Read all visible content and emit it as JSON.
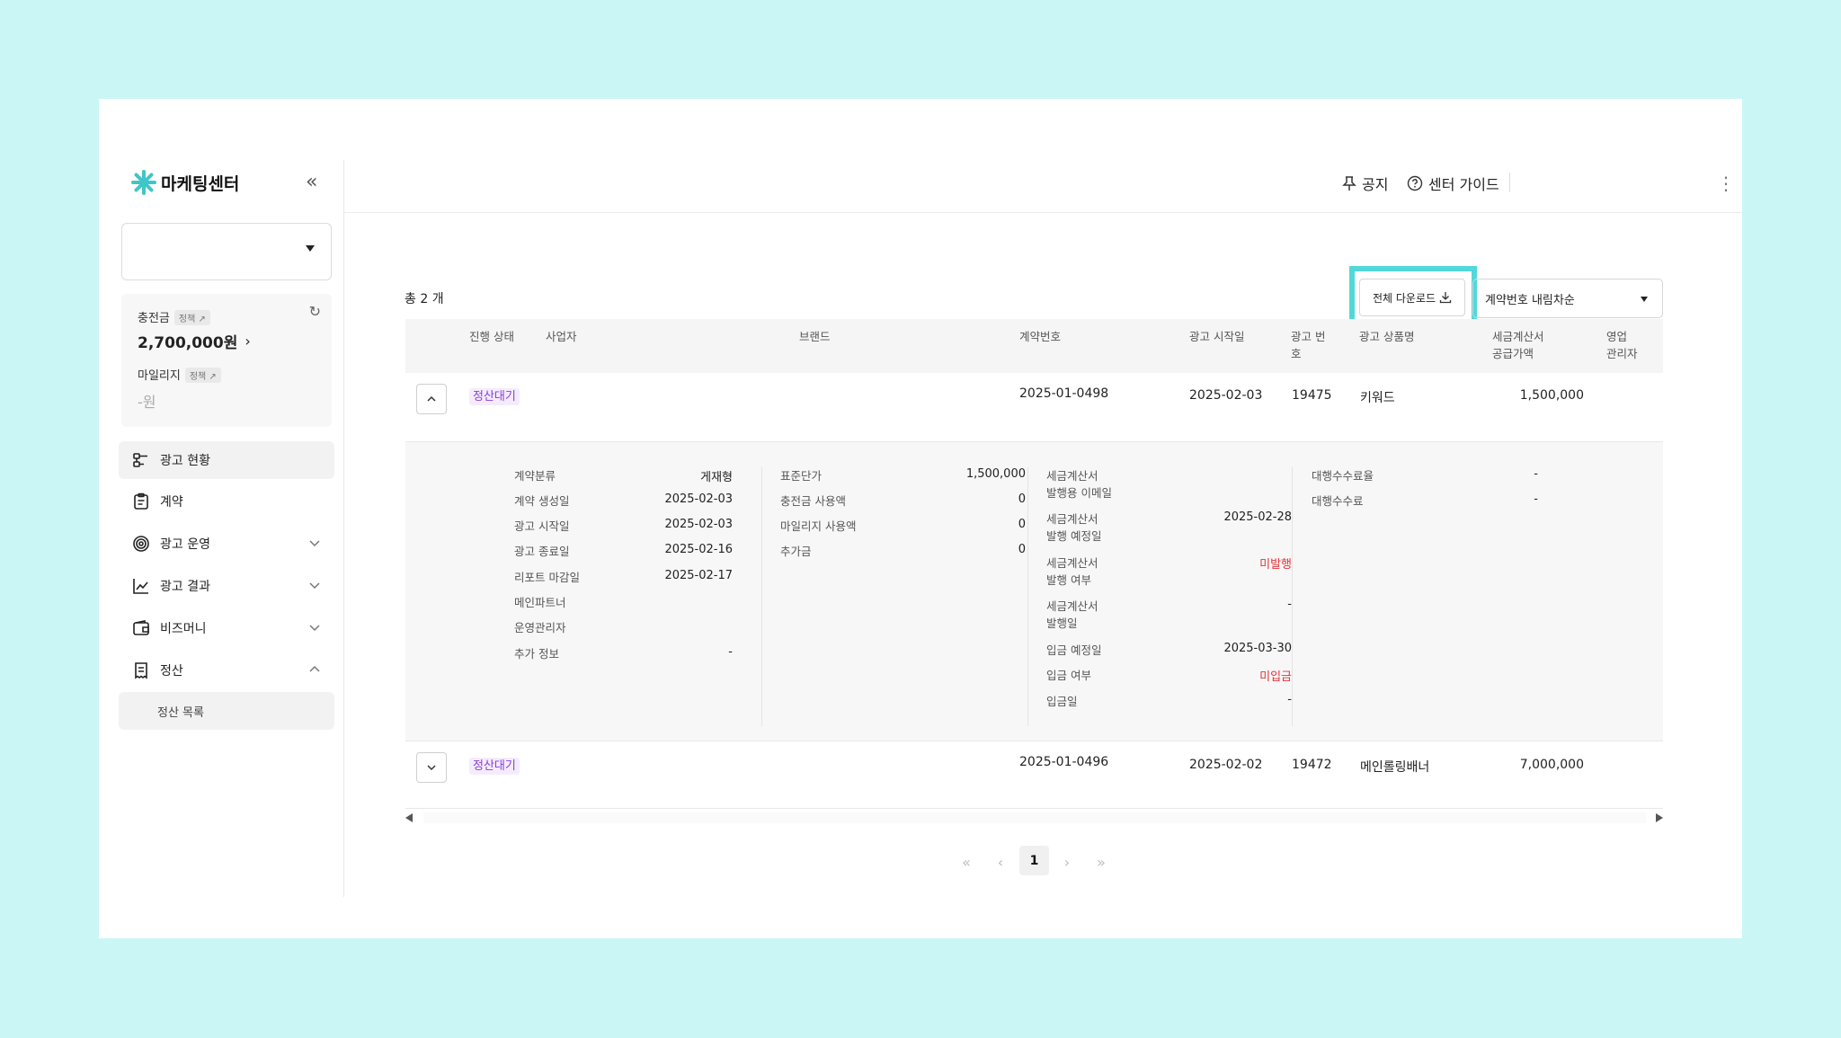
{
  "app": {
    "title": "마케팅센터"
  },
  "sidebar": {
    "balance": {
      "charge_label": "충전금",
      "charge_tag": "정책 ↗",
      "charge_amount": "2,700,000원",
      "mileage_label": "마일리지",
      "mileage_tag": "정책 ↗",
      "mileage_amount": "-원"
    },
    "menu": [
      {
        "label": "광고 현황"
      },
      {
        "label": "계약"
      },
      {
        "label": "광고 운영"
      },
      {
        "label": "광고 결과"
      },
      {
        "label": "비즈머니"
      },
      {
        "label": "정산"
      }
    ],
    "submenu": {
      "label": "정산 목록"
    }
  },
  "header": {
    "notice": "공지",
    "guide": "센터 가이드"
  },
  "toolbar": {
    "total": "총 2 개",
    "download": "전체 다운로드",
    "sort": "계약번호 내림차순"
  },
  "table": {
    "headers": {
      "status": "진행 상태",
      "business": "사업자",
      "brand": "브랜드",
      "contract_no": "계약번호",
      "ad_start": "광고 시작일",
      "ad_no": "광고 번\n호",
      "product": "광고 상품명",
      "tax_supply": "세금계산서\n공급가액",
      "sales_manager": "영업\n관리자"
    },
    "rows": [
      {
        "status": "정산대기",
        "contract_no": "2025-01-0498",
        "ad_start": "2025-02-03",
        "ad_no": "19475",
        "product": "키워드",
        "supply": "1,500,000"
      },
      {
        "status": "정산대기",
        "contract_no": "2025-01-0496",
        "ad_start": "2025-02-02",
        "ad_no": "19472",
        "product": "메인롤링배너",
        "supply": "7,000,000"
      }
    ],
    "detail": {
      "col1": [
        {
          "label": "계약분류",
          "value": "게재형"
        },
        {
          "label": "계약 생성일",
          "value": "2025-02-03"
        },
        {
          "label": "광고 시작일",
          "value": "2025-02-03"
        },
        {
          "label": "광고 종료일",
          "value": "2025-02-16"
        },
        {
          "label": "리포트 마감일",
          "value": "2025-02-17"
        },
        {
          "label": "메인파트너",
          "value": ""
        },
        {
          "label": "운영관리자",
          "value": ""
        },
        {
          "label": "추가 정보",
          "value": "-"
        }
      ],
      "col2": [
        {
          "label": "표준단가",
          "value": "1,500,000"
        },
        {
          "label": "충전금 사용액",
          "value": "0"
        },
        {
          "label": "마일리지 사용액",
          "value": "0"
        },
        {
          "label": "추가금",
          "value": "0"
        }
      ],
      "col3": [
        {
          "label": "세금계산서\n발행용 이메일",
          "value": ""
        },
        {
          "label": "세금계산서\n발행 예정일",
          "value": "2025-02-28"
        },
        {
          "label": "세금계산서\n발행 여부",
          "value": "미발행"
        },
        {
          "label": "세금계산서\n발행일",
          "value": "-"
        },
        {
          "label": "입금 예정일",
          "value": "2025-03-30"
        },
        {
          "label": "입금 여부",
          "value": "미입금"
        },
        {
          "label": "입금일",
          "value": "-"
        }
      ],
      "col4": [
        {
          "label": "대행수수료율",
          "value": "-"
        },
        {
          "label": "대행수수료",
          "value": "-"
        }
      ]
    }
  },
  "pagination": {
    "current": "1",
    "first": "«",
    "prev": "‹",
    "next": "›",
    "last": "»"
  },
  "colors": {
    "highlight": "#52d7da",
    "status_badge": "#8a3fd6",
    "alert": "#e5333c"
  }
}
